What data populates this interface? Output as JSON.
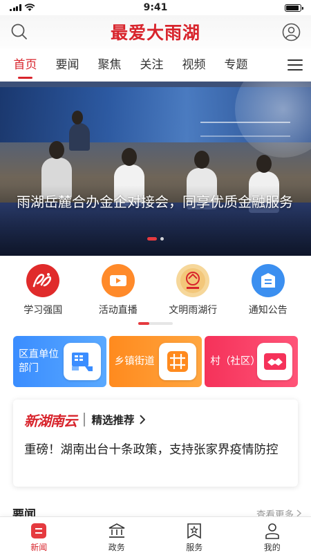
{
  "status_bar": {
    "time": "9:41",
    "battery_level": 0.9
  },
  "header": {
    "title": "最爱大雨湖",
    "search_icon": "search-icon",
    "profile_icon": "user-icon"
  },
  "tabs": [
    {
      "label": "首页",
      "active": true
    },
    {
      "label": "要闻",
      "active": false
    },
    {
      "label": "聚焦",
      "active": false
    },
    {
      "label": "关注",
      "active": false
    },
    {
      "label": "视频",
      "active": false
    },
    {
      "label": "专题",
      "active": false
    }
  ],
  "banner": {
    "caption": "雨湖岳麓合办金企对接会，同享优质金融服务",
    "slide_count": 2,
    "active_slide": 1
  },
  "quick_entries": [
    {
      "label": "学习强国",
      "icon": "study-icon",
      "color": "#e02b2b"
    },
    {
      "label": "活动直播",
      "icon": "video-icon",
      "color": "#ff8a2a"
    },
    {
      "label": "文明雨湖行",
      "icon": "civilization-emblem-icon",
      "color": "#f0c06a"
    },
    {
      "label": "通知公告",
      "icon": "notice-icon",
      "color": "#3b8ff0"
    }
  ],
  "cards": [
    {
      "label": "区直单位部门",
      "icon": "building-icon",
      "color_start": "#3a8dff",
      "color_end": "#5aa9ff",
      "accent": "#3a8dff"
    },
    {
      "label": "乡镇街道",
      "icon": "crossroad-icon",
      "color_start": "#ff8a1e",
      "color_end": "#ffa640",
      "accent": "#ff8a1e"
    },
    {
      "label": "村（社区）",
      "icon": "handshake-icon",
      "color_start": "#f5325a",
      "color_end": "#ff5478",
      "accent": "#f5325a"
    }
  ],
  "news_card": {
    "logo_text": "新湖南云",
    "recommend_label": "精选推荐",
    "headline": "重磅！湖南出台十条政策，支持张家界疫情防控"
  },
  "section": {
    "title": "要闻",
    "more_label": "查看更多"
  },
  "bottom_nav": [
    {
      "label": "新闻",
      "icon": "news-icon",
      "active": true
    },
    {
      "label": "政务",
      "icon": "government-icon",
      "active": false
    },
    {
      "label": "服务",
      "icon": "service-icon",
      "active": false
    },
    {
      "label": "我的",
      "icon": "profile-icon",
      "active": false
    }
  ],
  "colors": {
    "brand": "#d8242c",
    "accent_red": "#e53a3f"
  }
}
